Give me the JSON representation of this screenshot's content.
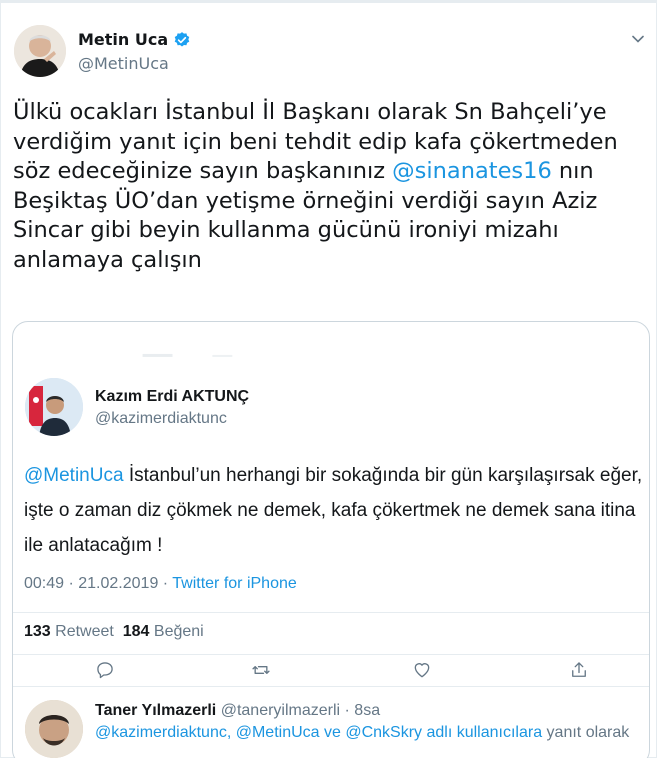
{
  "tweet": {
    "author_name": "Metin Uca",
    "author_handle": "@MetinUca",
    "text_part1": "Ülkü ocakları İstanbul İl Başkanı olarak Sn Bahçeli’ye verdiğim yanıt için beni tehdit edip kafa çökertmeden söz edeceğinize sayın başkanınız ",
    "mention": "@sinanates16",
    "text_part2": " nın Beşiktaş ÜO’dan yetişme örneğini verdiği sayın Aziz Sincar gibi beyin kullanma gücünü  ironiyi mizahı anlamaya çalışın"
  },
  "quoted": {
    "name": "Kazım Erdi AKTUNÇ",
    "handle": "@kazimerdiaktunc",
    "mention": "@MetinUca",
    "text": " İstanbul’un herhangi bir sokağında bir gün karşılaşırsak eğer, işte o zaman diz çökmek ne demek, kafa çökertmek ne demek sana itina ile anlatacağım !",
    "time": "00:49 · 21.02.2019 · ",
    "source": "Twitter for iPhone",
    "retweet_count": "133",
    "retweet_label": "Retweet",
    "like_count": "184",
    "like_label": "Beğeni"
  },
  "reply": {
    "name": "Taner Yılmazerli",
    "handle_time": "@taneryilmazerli · 8sa",
    "mentions": "@kazimerdiaktunc, @MetinUca ve @CnkSkry adlı kullanıcılara",
    "suffix": " yanıt olarak"
  },
  "colors": {
    "accent": "#1b95e0",
    "muted": "#657786",
    "text": "#14171a",
    "border": "#ccd6dd"
  },
  "icons": [
    "verified-badge-icon",
    "chevron-down-icon",
    "reply-icon",
    "retweet-icon",
    "like-icon",
    "share-icon"
  ]
}
